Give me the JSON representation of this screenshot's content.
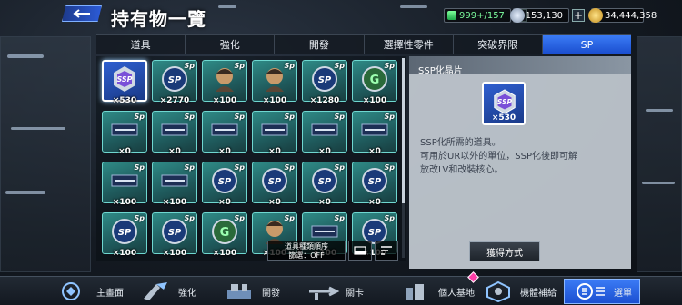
{
  "header": {
    "title": "持有物一覽",
    "resources": [
      {
        "icon": "energy-icon",
        "value": "999+/157"
      },
      {
        "icon": "gem-icon",
        "value": "153,130"
      },
      {
        "icon": "coin-icon",
        "value": "34,444,358"
      }
    ],
    "plus_label": "+"
  },
  "tabs": [
    {
      "label": "道具",
      "active": false
    },
    {
      "label": "強化",
      "active": false
    },
    {
      "label": "開發",
      "active": false
    },
    {
      "label": "選擇性零件",
      "active": false
    },
    {
      "label": "突破界限",
      "active": false
    },
    {
      "label": "SP",
      "active": true
    }
  ],
  "items": [
    {
      "qty": "×530",
      "art": "ssp-crystal",
      "sp": false,
      "selected": true
    },
    {
      "qty": "×2770",
      "art": "sp-chip",
      "sp": true
    },
    {
      "qty": "×100",
      "art": "pilot",
      "sp": true
    },
    {
      "qty": "×100",
      "art": "pilot",
      "sp": true
    },
    {
      "qty": "×1280",
      "art": "sp-chip",
      "sp": true
    },
    {
      "qty": "×100",
      "art": "gundam-chip",
      "sp": true
    },
    {
      "qty": "×0",
      "art": "logo",
      "sp": true
    },
    {
      "qty": "×0",
      "art": "logo",
      "sp": true
    },
    {
      "qty": "×0",
      "art": "logo",
      "sp": true
    },
    {
      "qty": "×0",
      "art": "logo",
      "sp": true
    },
    {
      "qty": "×0",
      "art": "logo",
      "sp": true
    },
    {
      "qty": "×0",
      "art": "logo",
      "sp": true
    },
    {
      "qty": "×100",
      "art": "logo",
      "sp": true
    },
    {
      "qty": "×100",
      "art": "logo",
      "sp": true
    },
    {
      "qty": "×0",
      "art": "sp-chip",
      "sp": true
    },
    {
      "qty": "×0",
      "art": "sp-chip",
      "sp": true
    },
    {
      "qty": "×0",
      "art": "sp-chip",
      "sp": true
    },
    {
      "qty": "×0",
      "art": "sp-chip",
      "sp": true
    },
    {
      "qty": "×100",
      "art": "sp-chip",
      "sp": true
    },
    {
      "qty": "×100",
      "art": "sp-chip",
      "sp": true
    },
    {
      "qty": "×100",
      "art": "gundam-chip",
      "sp": true
    },
    {
      "qty": "×100",
      "art": "pilot",
      "sp": true
    },
    {
      "qty": "×100",
      "art": "logo",
      "sp": true
    },
    {
      "qty": "×100",
      "art": "sp-chip",
      "sp": true
    }
  ],
  "sort": {
    "line1": "道具種類順序",
    "line2": "篩選：OFF"
  },
  "detail": {
    "title": "SSP化晶片",
    "qty": "×530",
    "desc_line1": "SSP化所需的道具。",
    "desc_line2": "可用於UR以外的單位，SSP化後即可解",
    "desc_line3": "放改LV和改裝核心。",
    "obtain_label": "獲得方式"
  },
  "nav": [
    {
      "label": "主畫面",
      "icon": "home-icon"
    },
    {
      "label": "強化",
      "icon": "enhance-icon"
    },
    {
      "label": "開發",
      "icon": "develop-icon"
    },
    {
      "label": "關卡",
      "icon": "stage-icon"
    },
    {
      "label": "個人基地",
      "icon": "base-icon"
    },
    {
      "label": "機體補給",
      "icon": "supply-icon"
    },
    {
      "label": "選單",
      "icon": "menu-icon"
    }
  ],
  "colors": {
    "accent": "#2c5bd6",
    "frame": "#6fd7d0",
    "tab_active": "#3b7bf5"
  }
}
